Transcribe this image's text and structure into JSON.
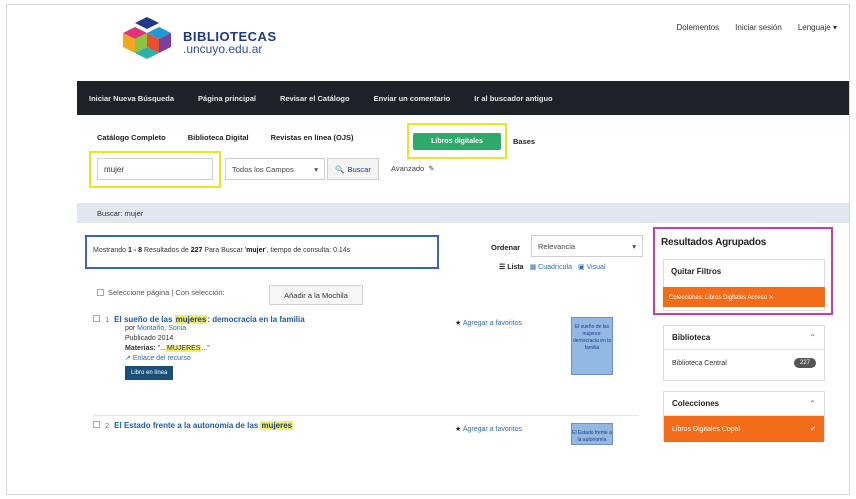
{
  "header": {
    "logo_title": "BIBLIOTECAS",
    "logo_sub": ".uncuyo.edu.ar",
    "links": [
      "Dolementos",
      "Iniciar sesión",
      "Lenguaje ▾"
    ]
  },
  "navbar": {
    "items": [
      "Iniciar Nueva Búsqueda",
      "Página principal",
      "Revisar el Catálogo",
      "Enviar un comentario",
      "Ir al buscador antiguo"
    ]
  },
  "tabs": {
    "items": [
      "Catálogo Completo",
      "Biblioteca Digital",
      "Revistas en línea (OJS)"
    ],
    "active": "Libros digitales",
    "last": "Bases"
  },
  "search": {
    "value": "mujer",
    "field_select": "Todos los Campos",
    "button": "Buscar",
    "advanced": "Avanzado"
  },
  "search_line": "Buscar: mujer",
  "summary": {
    "prefix": "Mostrando ",
    "range": "1 - 8",
    "mid": " Resultados de ",
    "total": "227",
    "mid2": " Para Buscar '",
    "query": "mujer",
    "suffix": "', tiempo de consulta: 0.14s"
  },
  "order": {
    "label": "Ordenar",
    "value": "Relevancia",
    "views": [
      "Lista",
      "Cuadrícula",
      "Visual"
    ]
  },
  "bulk": {
    "select_page": "Seleccione página | Con selección:",
    "button": "Añadir a la Mochila"
  },
  "results": [
    {
      "num": "1",
      "title_pre": "El sueño de las ",
      "title_hl": "mujeres",
      "title_post": ": democracia en la familia",
      "author_label": "por ",
      "author": "Montaño, Sonia",
      "published": "Publicado 2014",
      "materias_label": "Materias: ",
      "materias_pre": "\"...",
      "materias_hl": "MUJERES",
      "materias_post": "...\"",
      "link": "Enlace del recurso",
      "badge": "Libro en línea",
      "fav": "Agregar a favoritos",
      "cover": "El sueño de las mujeres: democracia en la familia"
    },
    {
      "num": "2",
      "title_pre": "El Estado frente a la autonomía de las ",
      "title_hl": "mujeres",
      "title_post": "",
      "fav": "Agregar a favoritos",
      "cover": "El Estado frente a la autonomía"
    }
  ],
  "sidebar": {
    "grouped_title": "Resultados Agrupados",
    "remove_filters": "Quitar Filtros",
    "active_filter": "Colecciones: Libros Digitales Acceso ✕",
    "biblioteca": {
      "title": "Biblioteca",
      "row": "Biblioteca Central",
      "count": "227"
    },
    "colecciones": {
      "title": "Colecciones",
      "row": "Libros Digitales Copal"
    }
  }
}
